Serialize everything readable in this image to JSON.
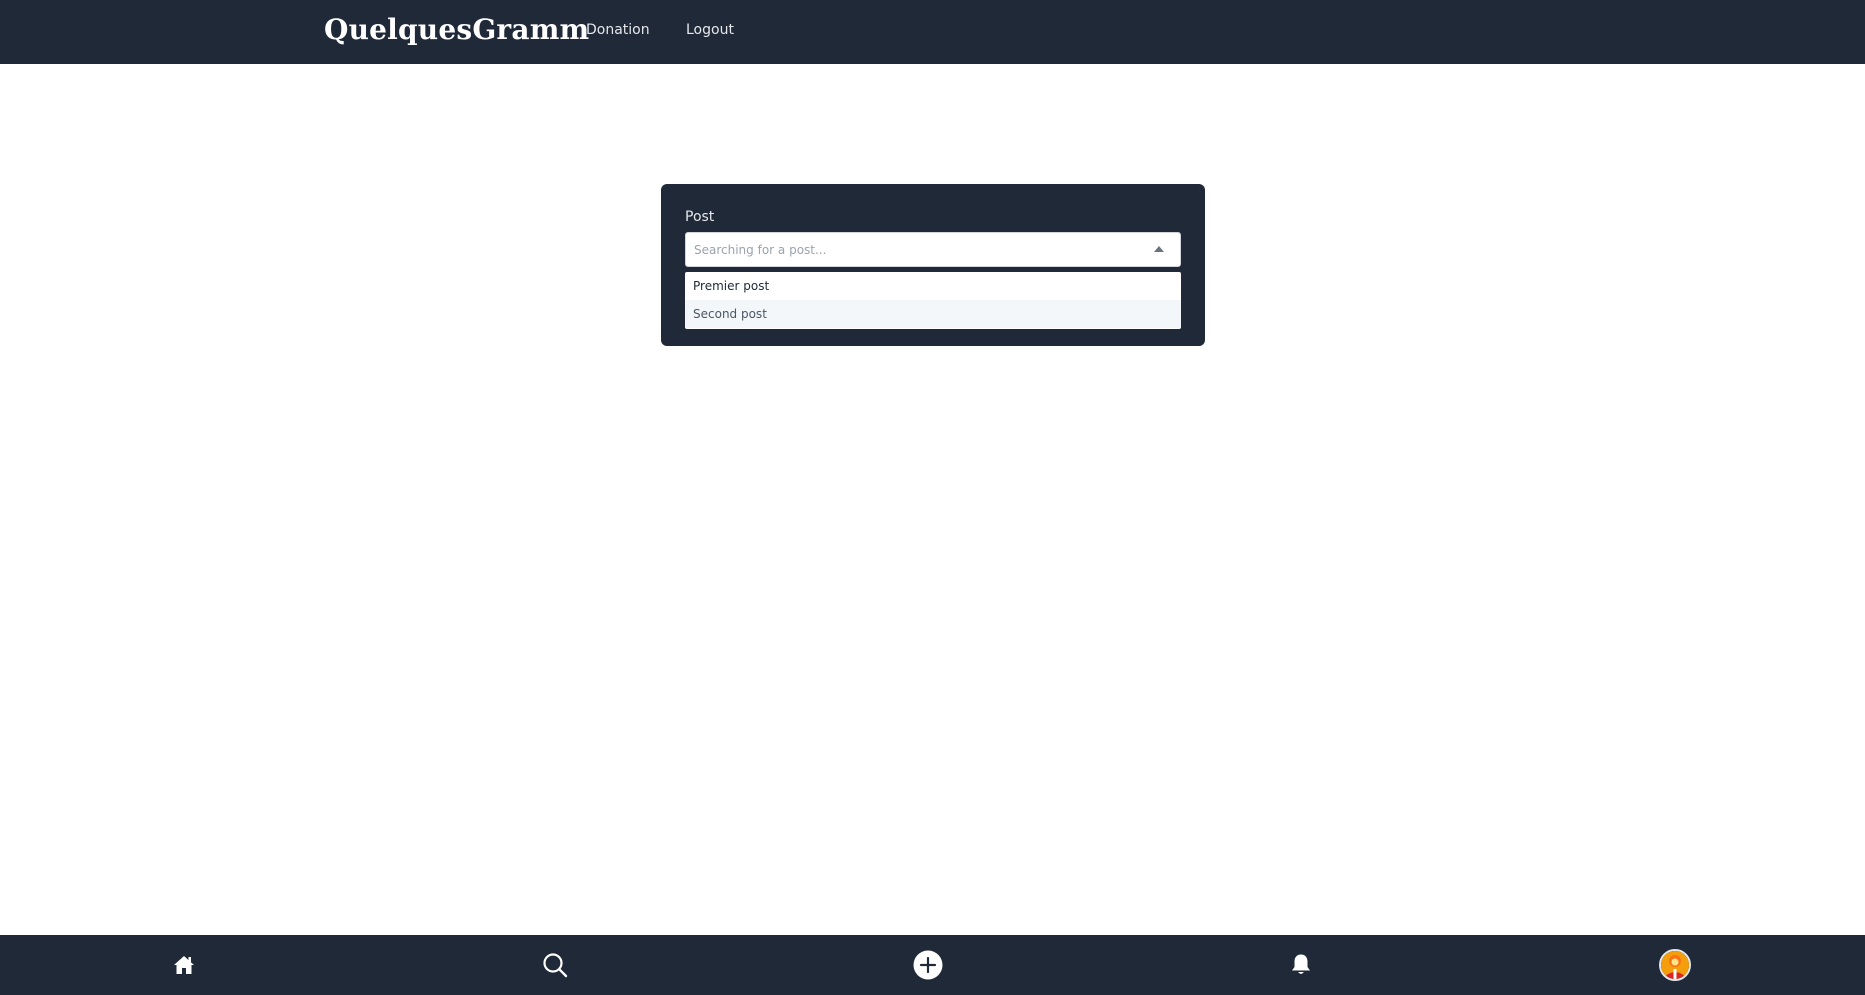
{
  "header": {
    "brand": "QuelquesGramm",
    "nav": [
      "Donation",
      "Logout"
    ]
  },
  "form": {
    "label": "Post",
    "placeholder": "Searching for a post...",
    "options": [
      "Premier post",
      "Second post"
    ],
    "highlighted_index": 1
  },
  "bottom_nav": {
    "icons": [
      "home-icon",
      "search-icon",
      "plus-circle-icon",
      "bell-icon",
      "avatar"
    ]
  },
  "colors": {
    "bar_background": "#1f2937",
    "page_background": "#ffffff",
    "highlight": "#f3f7fa"
  }
}
